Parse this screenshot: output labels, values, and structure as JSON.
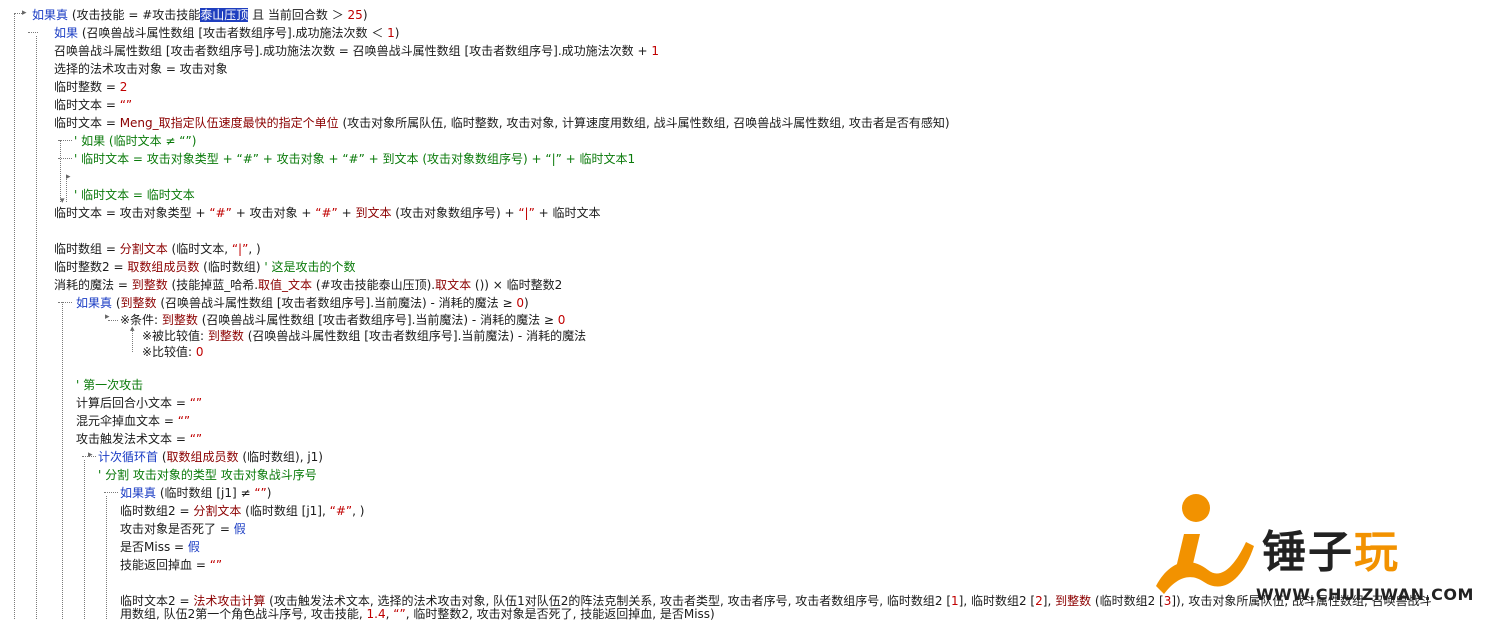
{
  "code_lines": [
    {
      "id": "l0",
      "segs": [
        {
          "t": "如果真",
          "c": "b"
        },
        {
          "t": " (攻击技能 = #攻击技能",
          "c": "k"
        },
        {
          "t": "泰山压顶",
          "c": "sel"
        },
        {
          "t": " 且 当前回合数 ＞ ",
          "c": "k"
        },
        {
          "t": "25",
          "c": "r"
        },
        {
          "t": ")",
          "c": "k"
        }
      ]
    },
    {
      "id": "l1",
      "segs": [
        {
          "t": "如果",
          "c": "b"
        },
        {
          "t": " (召唤兽战斗属性数组 [攻击者数组序号].成功施法次数 ＜ ",
          "c": "k"
        },
        {
          "t": "1",
          "c": "r"
        },
        {
          "t": ")",
          "c": "k"
        }
      ]
    },
    {
      "id": "l2",
      "segs": [
        {
          "t": "召唤兽战斗属性数组 [攻击者数组序号].成功施法次数 = 召唤兽战斗属性数组 [攻击者数组序号].成功施法次数 + ",
          "c": "k"
        },
        {
          "t": "1",
          "c": "r"
        }
      ]
    },
    {
      "id": "l3",
      "segs": [
        {
          "t": "选择的法术攻击对象 = 攻击对象",
          "c": "k"
        }
      ]
    },
    {
      "id": "l4",
      "segs": [
        {
          "t": "临时整数 = ",
          "c": "k"
        },
        {
          "t": "2",
          "c": "r"
        }
      ]
    },
    {
      "id": "l5",
      "segs": [
        {
          "t": "临时文本 = ",
          "c": "k"
        },
        {
          "t": "“”",
          "c": "r"
        }
      ]
    },
    {
      "id": "l6",
      "segs": [
        {
          "t": "临时文本 = ",
          "c": "k"
        },
        {
          "t": "Meng_取指定队伍速度最快的指定个单位",
          "c": "m"
        },
        {
          "t": " (攻击对象所属队伍, 临时整数, 攻击对象, 计算速度用数组, 战斗属性数组, 召唤兽战斗属性数组, 攻击者是否有感知)",
          "c": "k"
        }
      ]
    },
    {
      "id": "l7",
      "segs": [
        {
          "t": "' 如果 (临时文本 ≠ “”)",
          "c": "g"
        }
      ]
    },
    {
      "id": "l8",
      "segs": [
        {
          "t": "' 临时文本 = 攻击对象类型 + “#” + 攻击对象 + “#” + 到文本 (攻击对象数组序号) + “|” + 临时文本1",
          "c": "g"
        }
      ]
    },
    {
      "id": "l9",
      "segs": [
        {
          "t": "' 临时文本 = 临时文本",
          "c": "g"
        }
      ]
    },
    {
      "id": "l10",
      "segs": [
        {
          "t": "临时文本 = 攻击对象类型 + ",
          "c": "k"
        },
        {
          "t": "“#”",
          "c": "r"
        },
        {
          "t": " + 攻击对象 + ",
          "c": "k"
        },
        {
          "t": "“#”",
          "c": "r"
        },
        {
          "t": " + ",
          "c": "k"
        },
        {
          "t": "到文本",
          "c": "m"
        },
        {
          "t": " (攻击对象数组序号) + ",
          "c": "k"
        },
        {
          "t": "“|”",
          "c": "r"
        },
        {
          "t": " + 临时文本",
          "c": "k"
        }
      ]
    },
    {
      "id": "l11",
      "segs": [
        {
          "t": "临时数组 = ",
          "c": "k"
        },
        {
          "t": "分割文本",
          "c": "m"
        },
        {
          "t": " (临时文本, ",
          "c": "k"
        },
        {
          "t": "“|”",
          "c": "r"
        },
        {
          "t": ", )",
          "c": "k"
        }
      ]
    },
    {
      "id": "l12",
      "segs": [
        {
          "t": "临时整数2 = ",
          "c": "k"
        },
        {
          "t": "取数组成员数",
          "c": "m"
        },
        {
          "t": " (临时数组) ",
          "c": "k"
        },
        {
          "t": "' 这是攻击的个数",
          "c": "g"
        }
      ]
    },
    {
      "id": "l13",
      "segs": [
        {
          "t": "消耗的魔法 = ",
          "c": "k"
        },
        {
          "t": "到整数",
          "c": "m"
        },
        {
          "t": " (技能掉蓝_哈希.",
          "c": "k"
        },
        {
          "t": "取值_文本",
          "c": "m"
        },
        {
          "t": " (#攻击技能泰山压顶).",
          "c": "k"
        },
        {
          "t": "取文本",
          "c": "m"
        },
        {
          "t": " ()) × 临时整数2",
          "c": "k"
        }
      ]
    },
    {
      "id": "l14",
      "segs": [
        {
          "t": "如果真",
          "c": "b"
        },
        {
          "t": " (",
          "c": "k"
        },
        {
          "t": "到整数",
          "c": "m"
        },
        {
          "t": " (召唤兽战斗属性数组 [攻击者数组序号].当前魔法) - 消耗的魔法 ≥ ",
          "c": "k"
        },
        {
          "t": "0",
          "c": "r"
        },
        {
          "t": ")",
          "c": "k"
        }
      ]
    },
    {
      "id": "l15",
      "segs": [
        {
          "t": "※条件: ",
          "c": "k"
        },
        {
          "t": "到整数",
          "c": "m"
        },
        {
          "t": " (召唤兽战斗属性数组 [攻击者数组序号].当前魔法) - 消耗的魔法 ≥ ",
          "c": "k"
        },
        {
          "t": "0",
          "c": "r"
        }
      ]
    },
    {
      "id": "l16",
      "segs": [
        {
          "t": "※被比较值: ",
          "c": "k"
        },
        {
          "t": "到整数",
          "c": "m"
        },
        {
          "t": " (召唤兽战斗属性数组 [攻击者数组序号].当前魔法) - 消耗的魔法",
          "c": "k"
        }
      ]
    },
    {
      "id": "l17",
      "segs": [
        {
          "t": "※比较值: ",
          "c": "k"
        },
        {
          "t": "0",
          "c": "r"
        }
      ]
    },
    {
      "id": "l18",
      "segs": [
        {
          "t": "' 第一次攻击",
          "c": "g"
        }
      ]
    },
    {
      "id": "l19",
      "segs": [
        {
          "t": "计算后回合小文本 = ",
          "c": "k"
        },
        {
          "t": "“”",
          "c": "r"
        }
      ]
    },
    {
      "id": "l20",
      "segs": [
        {
          "t": "混元伞掉血文本 = ",
          "c": "k"
        },
        {
          "t": "“”",
          "c": "r"
        }
      ]
    },
    {
      "id": "l21",
      "segs": [
        {
          "t": "攻击触发法术文本 = ",
          "c": "k"
        },
        {
          "t": "“”",
          "c": "r"
        }
      ]
    },
    {
      "id": "l22",
      "segs": [
        {
          "t": "计次循环首",
          "c": "b"
        },
        {
          "t": " (",
          "c": "k"
        },
        {
          "t": "取数组成员数",
          "c": "m"
        },
        {
          "t": " (临时数组), j1)",
          "c": "k"
        }
      ]
    },
    {
      "id": "l23",
      "segs": [
        {
          "t": "' 分割 攻击对象的类型 攻击对象战斗序号",
          "c": "g"
        }
      ]
    },
    {
      "id": "l24",
      "segs": [
        {
          "t": "如果真",
          "c": "b"
        },
        {
          "t": " (临时数组 [j1] ≠ ",
          "c": "k"
        },
        {
          "t": "“”",
          "c": "r"
        },
        {
          "t": ")",
          "c": "k"
        }
      ]
    },
    {
      "id": "l25",
      "segs": [
        {
          "t": "临时数组2 = ",
          "c": "k"
        },
        {
          "t": "分割文本",
          "c": "m"
        },
        {
          "t": " (临时数组 [j1], ",
          "c": "k"
        },
        {
          "t": "“#”",
          "c": "r"
        },
        {
          "t": ", )",
          "c": "k"
        }
      ]
    },
    {
      "id": "l26",
      "segs": [
        {
          "t": "攻击对象是否死了 = ",
          "c": "k"
        },
        {
          "t": "假",
          "c": "b"
        }
      ]
    },
    {
      "id": "l27",
      "segs": [
        {
          "t": "是否Miss = ",
          "c": "k"
        },
        {
          "t": "假",
          "c": "b"
        }
      ]
    },
    {
      "id": "l28",
      "segs": [
        {
          "t": "技能返回掉血 = ",
          "c": "k"
        },
        {
          "t": "“”",
          "c": "r"
        }
      ]
    },
    {
      "id": "l29",
      "segs": [
        {
          "t": "临时文本2 = ",
          "c": "k"
        },
        {
          "t": "法术攻击计算",
          "c": "m"
        },
        {
          "t": " (攻击触发法术文本, 选择的法术攻击对象, 队伍1对队伍2的阵法克制关系, 攻击者类型, 攻击者序号, 攻击者数组序号, 临时数组2 [",
          "c": "k"
        },
        {
          "t": "1",
          "c": "r"
        },
        {
          "t": "], 临时数组2 [",
          "c": "k"
        },
        {
          "t": "2",
          "c": "r"
        },
        {
          "t": "], ",
          "c": "k"
        },
        {
          "t": "到整数",
          "c": "m"
        },
        {
          "t": " (临时数组2 [",
          "c": "k"
        },
        {
          "t": "3",
          "c": "r"
        },
        {
          "t": "]), 攻击对象所属队伍, 战斗属性数组, 召唤兽战斗",
          "c": "k"
        }
      ]
    },
    {
      "id": "l30",
      "segs": [
        {
          "t": "用数组, 队伍2第一个角色战斗序号, 攻击技能, ",
          "c": "k"
        },
        {
          "t": "1.4",
          "c": "r"
        },
        {
          "t": ", ",
          "c": "k"
        },
        {
          "t": "“”",
          "c": "r"
        },
        {
          "t": ", 临时整数2, 攻击对象是否死了, 技能返回掉血, 是否Miss)",
          "c": "k"
        }
      ]
    }
  ],
  "watermark": {
    "brand_prefix": "锤子",
    "brand_highlight": "玩",
    "url": "WWW.CHUIZIWAN.COM"
  },
  "colors": {
    "keyword_blue": "#1a3cc4",
    "function_maroon": "#8b0000",
    "literal_red": "#c00000",
    "comment_green": "#0a7a0a",
    "selection_bg": "#1f3fbf",
    "watermark_orange": "#f29200"
  }
}
